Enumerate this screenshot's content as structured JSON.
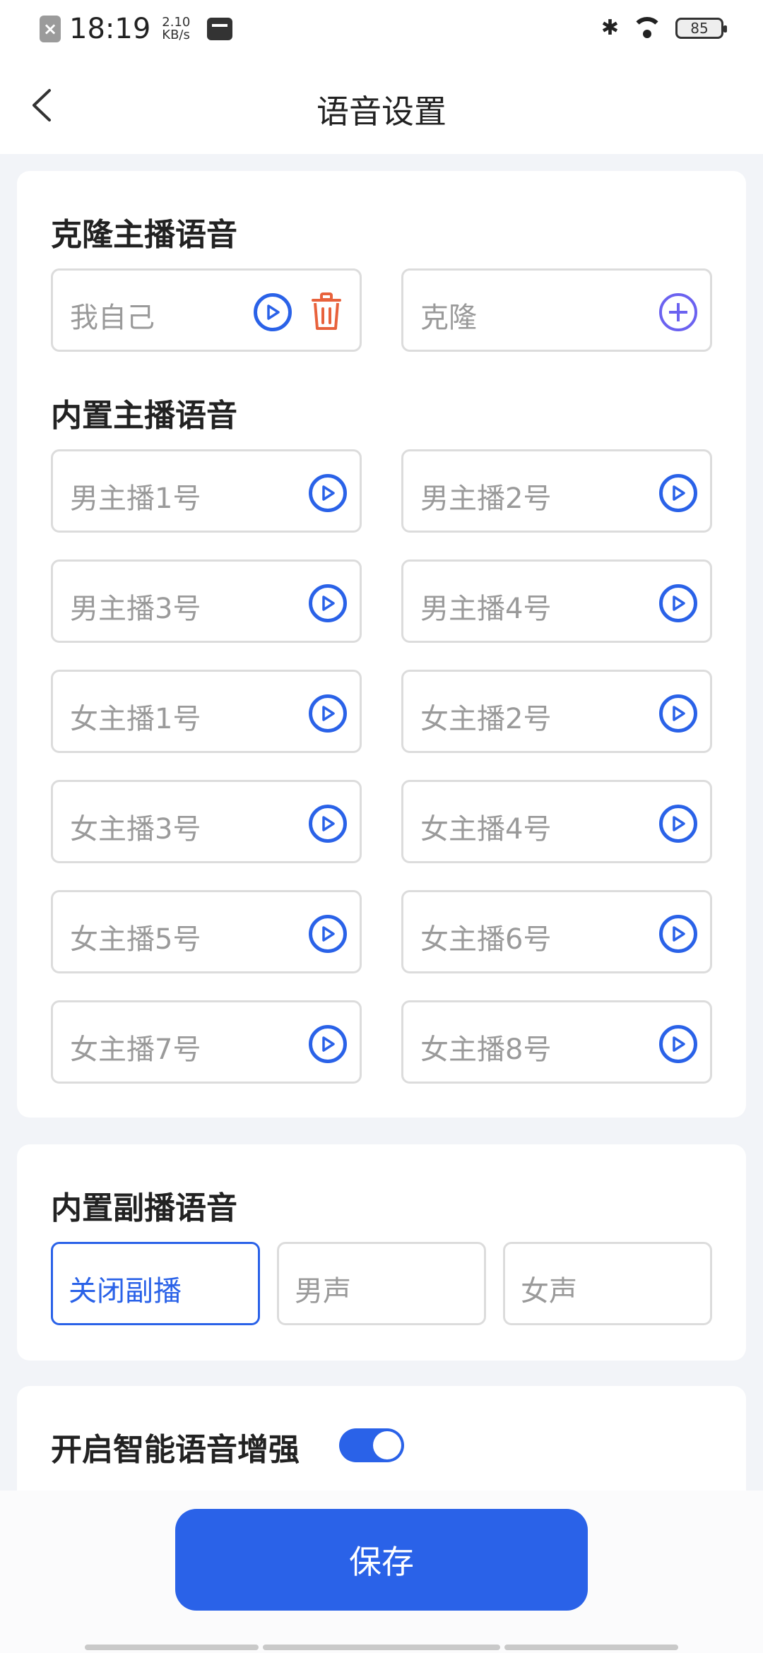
{
  "status_bar": {
    "time": "18:19",
    "speed_value": "2.10",
    "speed_unit": "KB/s",
    "battery": "85"
  },
  "header": {
    "title": "语音设置"
  },
  "clone": {
    "section_title": "克隆主播语音",
    "items": [
      {
        "label": "我自己"
      },
      {
        "label": "克隆"
      }
    ]
  },
  "builtin": {
    "section_title": "内置主播语音",
    "items": [
      {
        "label": "男主播1号"
      },
      {
        "label": "男主播2号"
      },
      {
        "label": "男主播3号"
      },
      {
        "label": "男主播4号"
      },
      {
        "label": "女主播1号"
      },
      {
        "label": "女主播2号"
      },
      {
        "label": "女主播3号"
      },
      {
        "label": "女主播4号"
      },
      {
        "label": "女主播5号"
      },
      {
        "label": "女主播6号"
      },
      {
        "label": "女主播7号"
      },
      {
        "label": "女主播8号"
      }
    ]
  },
  "secondary": {
    "section_title": "内置副播语音",
    "options": [
      {
        "label": "关闭副播",
        "selected": true
      },
      {
        "label": "男声",
        "selected": false
      },
      {
        "label": "女声",
        "selected": false
      }
    ]
  },
  "enhance": {
    "label": "开启智能语音增强",
    "enabled": true
  },
  "footer": {
    "save_label": "保存"
  },
  "colors": {
    "accent": "#2a62e8",
    "delete": "#e8623c",
    "add": "#6b62f0"
  }
}
